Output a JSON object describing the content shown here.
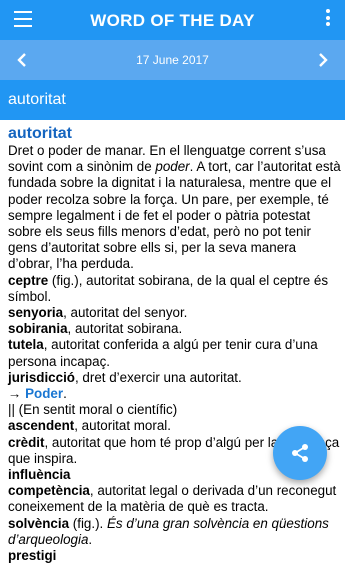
{
  "appbar": {
    "title": "WORD OF THE DAY"
  },
  "datebar": {
    "date": "17 June 2017"
  },
  "wordbar": {
    "word": "autoritat"
  },
  "entry": {
    "headword": "autoritat",
    "definition_part1": "Dret o poder de manar. En el llenguatge corrent s’usa sovint com a sinònim de ",
    "definition_poder": "poder",
    "definition_part2": ". A tort, car l’autoritat està fundada sobre la dignitat i la naturalesa, mentre que el poder recolza sobre la força. Un pare, per exemple, té sempre legalment i de fet el poder o pàtria potestat sobre els seus fills menors d’edat, però no pot tenir gens d’autoritat sobre ells si, per la seva manera d’obrar, l’ha perduda.",
    "senses": [
      {
        "term": "ceptre",
        "text": " (fig.), autoritat sobirana, de la qual el ceptre és símbol."
      },
      {
        "term": "senyoria",
        "text": ", autoritat del senyor."
      },
      {
        "term": "sobirania",
        "text": ", autoritat sobirana."
      },
      {
        "term": "tutela",
        "text": ", autoritat conferida a algú per tenir cura d’una persona incapaç."
      },
      {
        "term": "jurisdicció",
        "text": ", dret d’exercir una autoritat."
      }
    ],
    "see_arrow": "→ ",
    "see_link": "Poder",
    "see_end": ".",
    "moral_note": "|| (En sentit moral o científic)",
    "senses2": [
      {
        "term": "ascendent",
        "text": ", autoritat moral."
      },
      {
        "term": "crèdit",
        "text": ", autoritat que hom té prop d’algú per la confiança que inspira."
      },
      {
        "term": "influència",
        "text": ""
      },
      {
        "term": "competència",
        "text": ", autoritat legal o derivada d’un reconegut coneixement de la matèria de què es tracta."
      }
    ],
    "solvencia_term": "solvència",
    "solvencia_text": " (fig.). ",
    "solvencia_example": "És d’una gran solvència en qüestions d’arqueologia",
    "solvencia_end": ".",
    "cutoff_term": "prestigi"
  },
  "icons": {
    "menu": "menu-icon",
    "more": "more-vertical-icon",
    "prev": "chevron-left-icon",
    "next": "chevron-right-icon",
    "share": "share-icon"
  },
  "colors": {
    "primary": "#2196F3",
    "date_bar": "#5BA8F0",
    "headword": "#1565C0",
    "fab": "#42A5F5"
  }
}
